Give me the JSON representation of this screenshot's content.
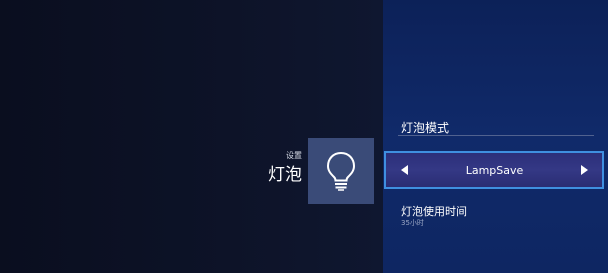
{
  "breadcrumb": "设置",
  "category": {
    "title": "灯泡",
    "icon": "lightbulb-icon"
  },
  "panel": {
    "section_label": "灯泡模式",
    "mode_selector": {
      "value": "LampSave",
      "left_icon": "arrow-left-icon",
      "right_icon": "arrow-right-icon"
    },
    "usage": {
      "label": "灯泡使用时间",
      "value": "35小时"
    }
  },
  "colors": {
    "left_background": "#0b1022",
    "right_background": "#0f2866",
    "tile": "#3a4b78",
    "selector_fill": "#2f337e",
    "selector_border": "#3f8fe0"
  }
}
